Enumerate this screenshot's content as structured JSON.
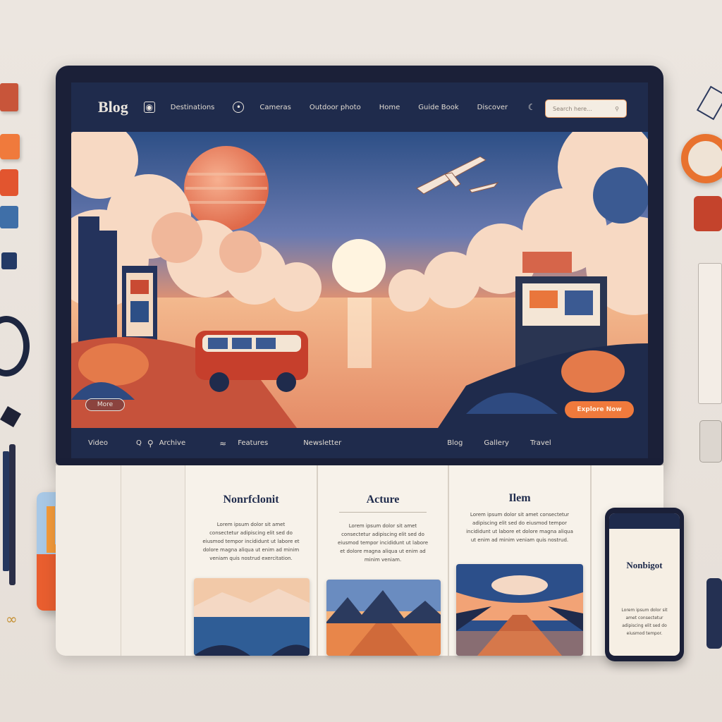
{
  "header": {
    "brand": "Blog",
    "nav_links": [
      "Destinations",
      "Cameras",
      "Outdoor photo",
      "Home",
      "Guide Book",
      "Discover"
    ],
    "search_placeholder": "Search here..."
  },
  "hero": {
    "left_button": "More",
    "right_button": "Explore Now"
  },
  "bottom_nav": {
    "items": [
      "Video",
      "Q",
      "Archive",
      "Features",
      "Newsletter",
      "Blog",
      "Gallery",
      "Travel"
    ]
  },
  "articles": [
    {
      "title": "Nonrfclonit",
      "text": "Lorem ipsum dolor sit amet consectetur adipiscing elit sed do eiusmod tempor incididunt ut labore et dolore magna aliqua ut enim ad minim veniam quis nostrud exercitation."
    },
    {
      "title": "Acture",
      "text": "Lorem ipsum dolor sit amet consectetur adipiscing elit sed do eiusmod tempor incididunt ut labore et dolore magna aliqua ut enim ad minim veniam."
    },
    {
      "title": "Ilem",
      "text": "Lorem ipsum dolor sit amet consectetur adipiscing elit sed do eiusmod tempor incididunt ut labore et dolore magna aliqua ut enim ad minim veniam quis nostrud."
    }
  ],
  "phone": {
    "title": "Nonbigot",
    "text": "Lorem ipsum dolor sit amet consectetur adipiscing elit sed do eiusmod tempor."
  },
  "colors": {
    "navy": "#1f2b4c",
    "accent": "#f07a3c",
    "paper": "#f7f2ea"
  }
}
